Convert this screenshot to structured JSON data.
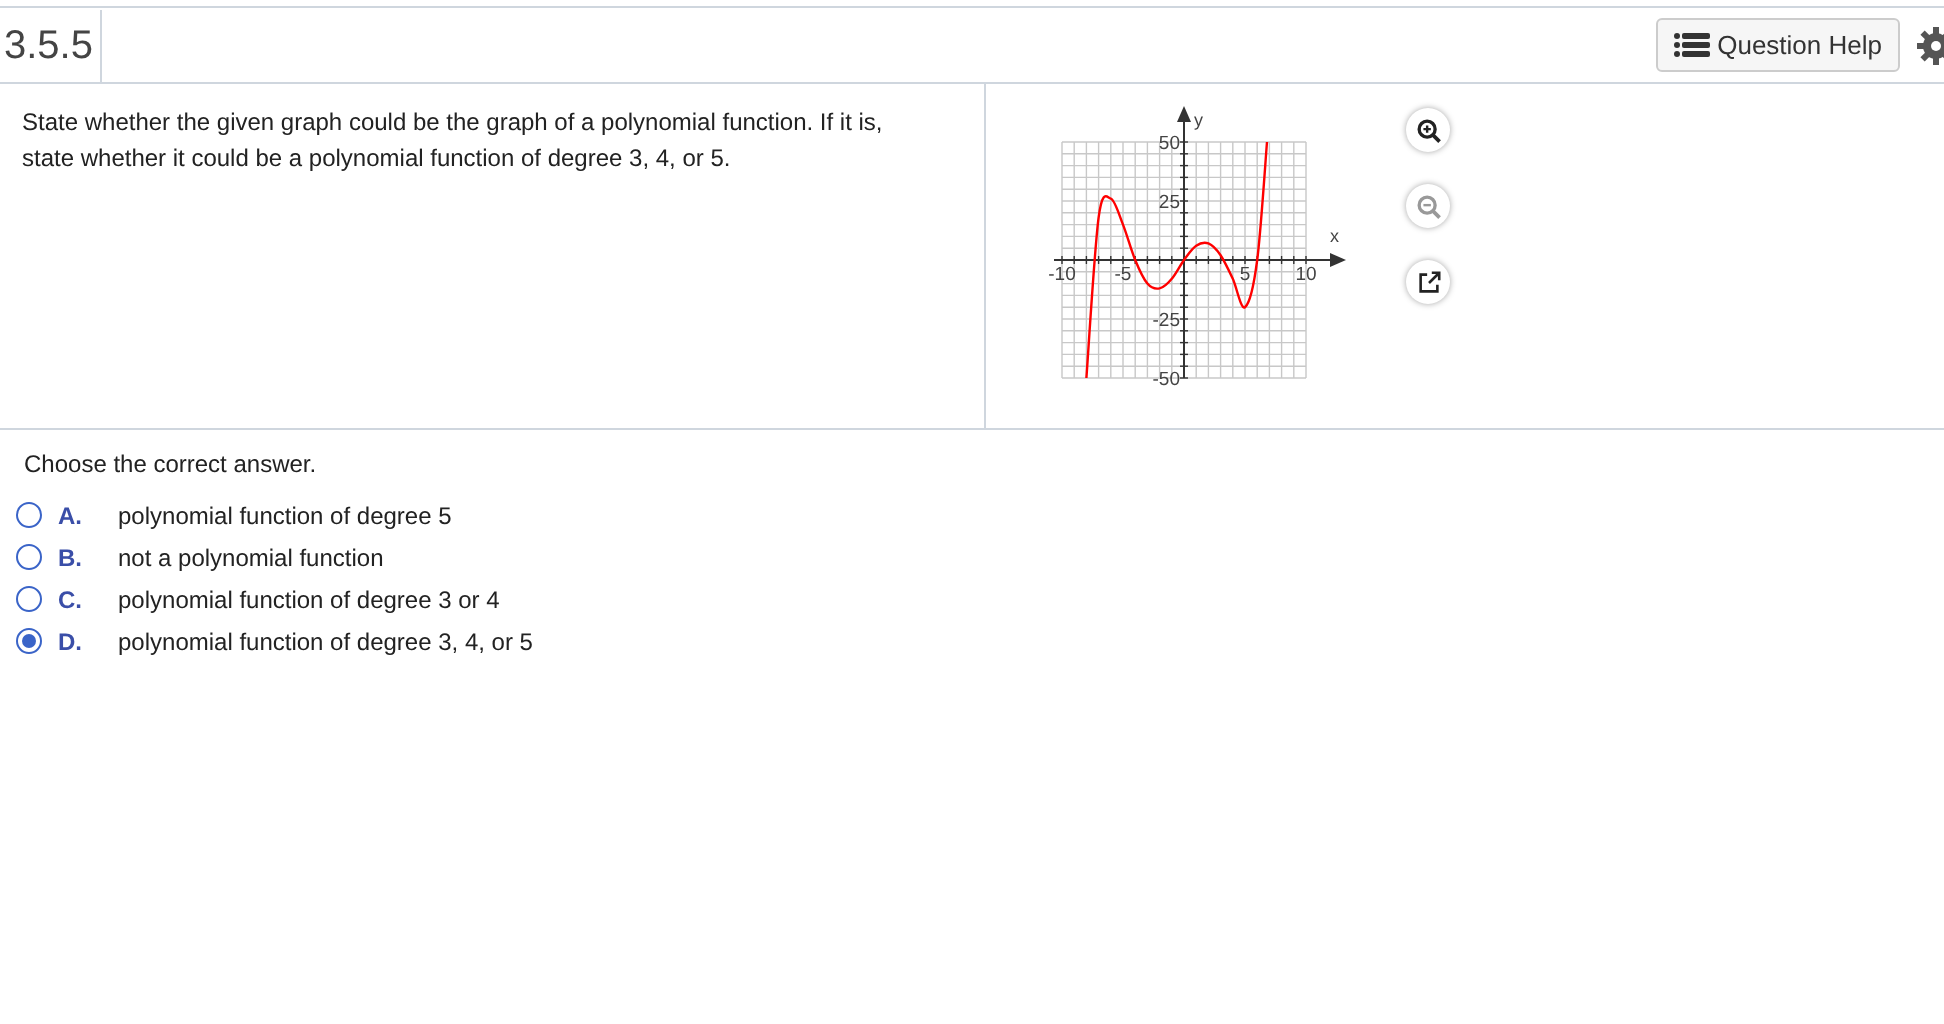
{
  "header": {
    "title": "3.5.5",
    "help_button": "Question Help"
  },
  "question": {
    "text": "State whether the given graph could be the graph of a polynomial function. If it is, state whether it could be a polynomial function of degree 3, 4, or 5."
  },
  "graph": {
    "chart_data": {
      "type": "line",
      "xlabel": "x",
      "ylabel": "y",
      "xlim": [
        -10,
        10
      ],
      "ylim": [
        -50,
        50
      ],
      "xticks": [
        {
          "value": -10,
          "label": "-10"
        },
        {
          "value": -5,
          "label": "-5"
        },
        {
          "value": 5,
          "label": "5"
        },
        {
          "value": 10,
          "label": "10"
        }
      ],
      "yticks": [
        {
          "value": 50,
          "label": "50"
        },
        {
          "value": 25,
          "label": "25"
        },
        {
          "value": -25,
          "label": "-25"
        },
        {
          "value": -50,
          "label": "-50"
        }
      ],
      "grid": true,
      "x": [
        -8,
        -7,
        -6,
        -5,
        -4,
        -3,
        -2,
        -1,
        0,
        1,
        2,
        3,
        4,
        5,
        6,
        6.8
      ],
      "series": [
        {
          "color": "#ff0000",
          "values": [
            -50,
            18,
            26,
            15,
            0,
            -10,
            -12,
            -8,
            0,
            6,
            7,
            2,
            -8,
            -20,
            0,
            50
          ]
        }
      ]
    }
  },
  "instruction": "Choose the correct answer.",
  "options": [
    {
      "letter": "A.",
      "text": "polynomial function of degree 5",
      "selected": false
    },
    {
      "letter": "B.",
      "text": "not a polynomial function",
      "selected": false
    },
    {
      "letter": "C.",
      "text": "polynomial function of degree 3 or 4",
      "selected": false
    },
    {
      "letter": "D.",
      "text": "polynomial function of degree 3, 4, or 5",
      "selected": true
    }
  ]
}
